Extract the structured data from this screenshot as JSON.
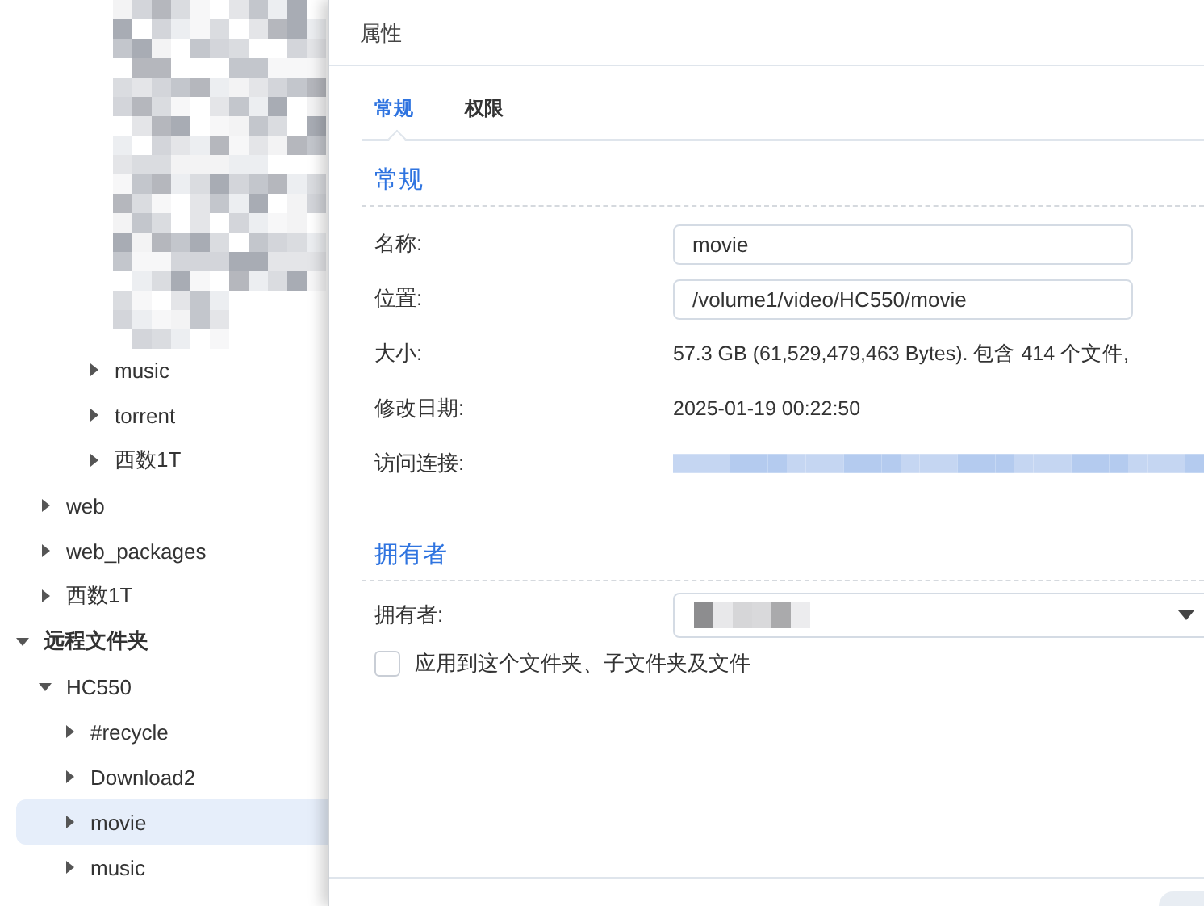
{
  "tree": {
    "items": [
      {
        "children": [
          {
            "children": [
              {
                "children": [
                  {
                    "label": "music",
                    "expanded": false,
                    "selected": false
                  },
                  {
                    "label": "torrent",
                    "expanded": false,
                    "selected": false
                  },
                  {
                    "label": "西数1T",
                    "expanded": false,
                    "selected": false
                  }
                ]
              }
            ]
          },
          {
            "label": "web",
            "expanded": false,
            "selected": false
          },
          {
            "label": "web_packages",
            "expanded": false,
            "selected": false
          },
          {
            "label": "西数1T",
            "expanded": false,
            "selected": false
          }
        ]
      },
      {
        "label": "远程文件夹",
        "kind": "group",
        "expanded": true,
        "selected": false,
        "children": [
          {
            "label": "HC550",
            "expanded": true,
            "selected": false,
            "children": [
              {
                "label": "#recycle",
                "expanded": false,
                "selected": false
              },
              {
                "label": "Download2",
                "expanded": false,
                "selected": false
              },
              {
                "label": "movie",
                "expanded": false,
                "selected": true
              },
              {
                "label": "music",
                "expanded": false,
                "selected": false
              }
            ]
          }
        ]
      }
    ]
  },
  "dialog": {
    "title": "属性",
    "tabs": [
      {
        "label": "常规",
        "selected": true
      },
      {
        "label": "权限",
        "selected": false
      }
    ],
    "general": {
      "heading": "常规",
      "rows": [
        {
          "label": "名称:",
          "kind": "field",
          "value": "movie"
        },
        {
          "label": "位置:",
          "kind": "field",
          "value": "/volume1/video/HC550/movie"
        },
        {
          "label": "大小:",
          "kind": "text",
          "value": "57.3 GB (61,529,479,463 Bytes). 包含 414 个文件,"
        },
        {
          "label": "修改日期:",
          "kind": "text",
          "value": "2025-01-19 00:22:50"
        },
        {
          "label": "访问连接:",
          "kind": "obscured"
        }
      ]
    },
    "owner": {
      "heading": "拥有者",
      "label": "拥有者:",
      "checkbox": {
        "label": "应用到这个文件夹、子文件夹及文件",
        "checked": false
      }
    }
  }
}
